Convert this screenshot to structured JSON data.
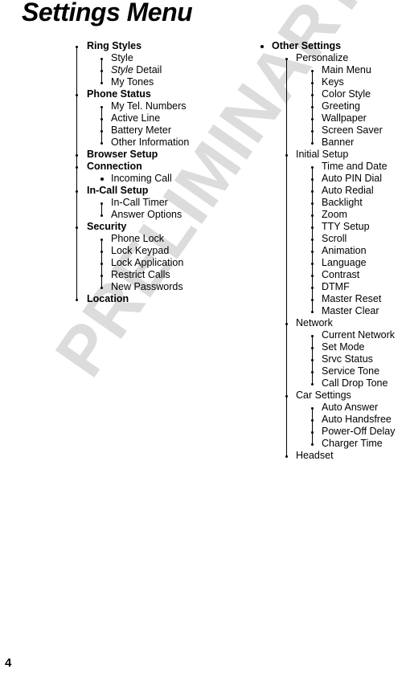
{
  "document": {
    "title": "Settings Menu",
    "page_number": "4",
    "watermark": "PRELIMINARY",
    "watermark_color": "#dcdcdc",
    "text_color": "#000000",
    "background_color": "#ffffff"
  },
  "columns": {
    "left": {
      "items": [
        {
          "label": "Ring Styles",
          "level": 1
        },
        {
          "label": "Style",
          "level": 2
        },
        {
          "label": "Style Detail",
          "level": 2,
          "italic_prefix": "Style",
          "rest": " Detail"
        },
        {
          "label": "My Tones",
          "level": 2
        },
        {
          "label": "Phone Status",
          "level": 1
        },
        {
          "label": "My Tel. Numbers",
          "level": 2
        },
        {
          "label": "Active Line",
          "level": 2
        },
        {
          "label": "Battery Meter",
          "level": 2
        },
        {
          "label": "Other Information",
          "level": 2
        },
        {
          "label": "Browser Setup",
          "level": 1
        },
        {
          "label": "Connection",
          "level": 1
        },
        {
          "label": "Incoming Call",
          "level": 2
        },
        {
          "label": "In-Call Setup",
          "level": 1
        },
        {
          "label": "In-Call Timer",
          "level": 2
        },
        {
          "label": "Answer Options",
          "level": 2
        },
        {
          "label": "Security",
          "level": 1
        },
        {
          "label": "Phone Lock",
          "level": 2
        },
        {
          "label": "Lock Keypad",
          "level": 2
        },
        {
          "label": "Lock Application",
          "level": 2
        },
        {
          "label": "Restrict Calls",
          "level": 2
        },
        {
          "label": "New Passwords",
          "level": 2
        },
        {
          "label": "Location",
          "level": 1
        }
      ]
    },
    "right": {
      "items": [
        {
          "label": "Other Settings",
          "level": 1
        },
        {
          "label": "Personalize",
          "level": 2
        },
        {
          "label": "Main Menu",
          "level": 3
        },
        {
          "label": "Keys",
          "level": 3
        },
        {
          "label": "Color Style",
          "level": 3
        },
        {
          "label": "Greeting",
          "level": 3
        },
        {
          "label": "Wallpaper",
          "level": 3
        },
        {
          "label": "Screen Saver",
          "level": 3
        },
        {
          "label": "Banner",
          "level": 3
        },
        {
          "label": "Initial Setup",
          "level": 2
        },
        {
          "label": "Time and Date",
          "level": 3
        },
        {
          "label": "Auto PIN Dial",
          "level": 3
        },
        {
          "label": "Auto Redial",
          "level": 3
        },
        {
          "label": "Backlight",
          "level": 3
        },
        {
          "label": "Zoom",
          "level": 3
        },
        {
          "label": "TTY Setup",
          "level": 3
        },
        {
          "label": "Scroll",
          "level": 3
        },
        {
          "label": "Animation",
          "level": 3
        },
        {
          "label": "Language",
          "level": 3
        },
        {
          "label": "Contrast",
          "level": 3
        },
        {
          "label": "DTMF",
          "level": 3
        },
        {
          "label": "Master Reset",
          "level": 3
        },
        {
          "label": "Master Clear",
          "level": 3
        },
        {
          "label": "Network",
          "level": 2
        },
        {
          "label": "Current Network",
          "level": 3
        },
        {
          "label": "Set Mode",
          "level": 3
        },
        {
          "label": "Srvc Status",
          "level": 3
        },
        {
          "label": "Service Tone",
          "level": 3
        },
        {
          "label": "Call Drop Tone",
          "level": 3
        },
        {
          "label": "Car Settings",
          "level": 2
        },
        {
          "label": "Auto Answer",
          "level": 3
        },
        {
          "label": "Auto Handsfree",
          "level": 3
        },
        {
          "label": "Power-Off Delay",
          "level": 3
        },
        {
          "label": "Charger Time",
          "level": 3
        },
        {
          "label": "Headset",
          "level": 2
        }
      ]
    }
  }
}
